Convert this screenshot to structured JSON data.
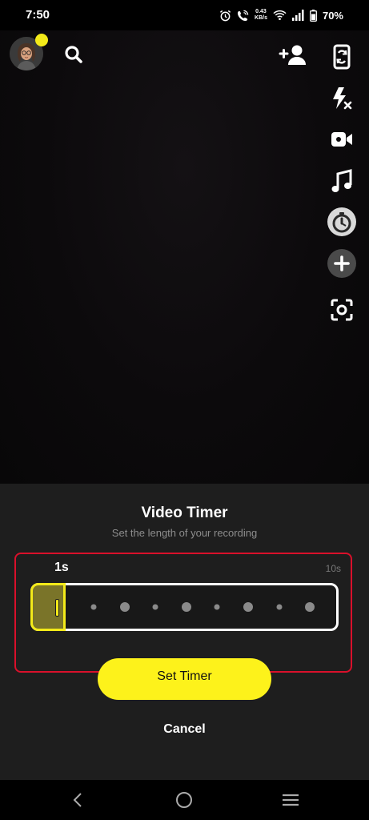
{
  "status_bar": {
    "time": "7:50",
    "net_speed_value": "0.43",
    "net_speed_unit": "KB/s",
    "battery": "70%"
  },
  "camera": {
    "top_icons": [
      "avatar",
      "search-icon",
      "add-friend-icon"
    ],
    "tools": [
      "flip-camera-icon",
      "flash-off-icon",
      "video-chat-icon",
      "music-note-icon",
      "timer-icon",
      "plus-icon",
      "scan-icon"
    ]
  },
  "timer_sheet": {
    "title": "Video Timer",
    "subtitle": "Set the length of your recording",
    "current_value": "1s",
    "max_value": "10s",
    "selected_seconds": 1,
    "max_seconds": 10,
    "set_button_label": "Set Timer",
    "cancel_label": "Cancel"
  },
  "colors": {
    "accent": "#fdf21b",
    "highlight": "#d9102b",
    "sheet_bg": "#1e1e1e"
  }
}
